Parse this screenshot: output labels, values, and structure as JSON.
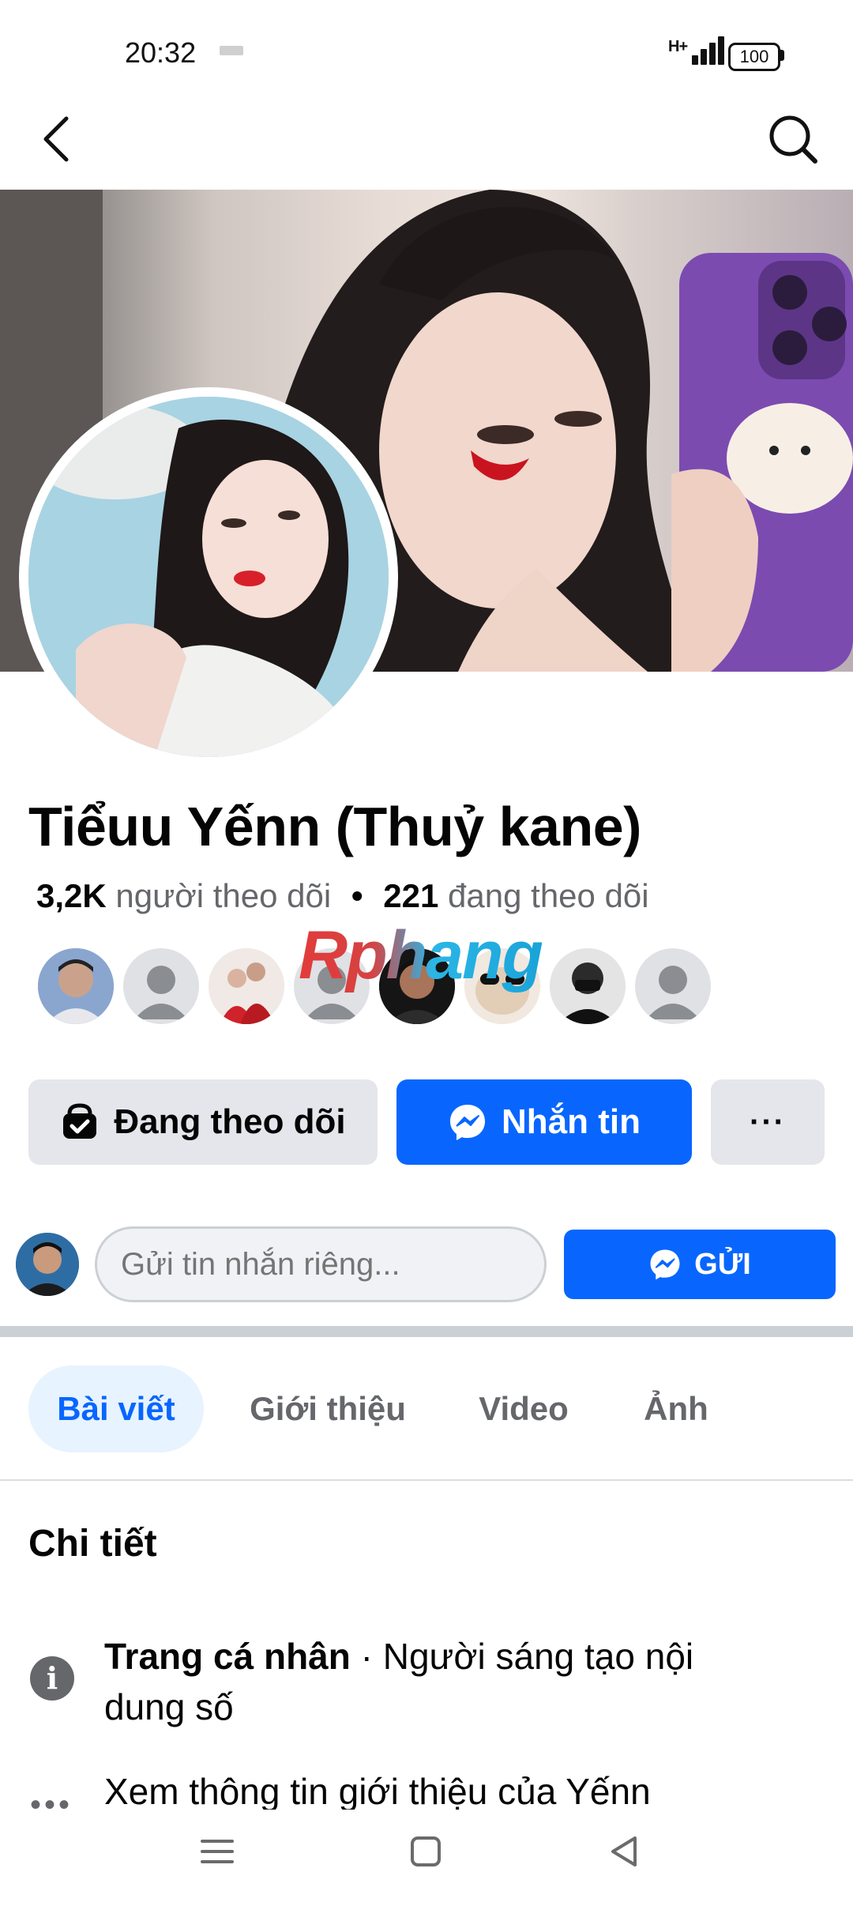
{
  "status_bar": {
    "time": "20:32",
    "network": "H+",
    "battery": "100"
  },
  "top_bar": {
    "back_icon": "chevron-left-icon",
    "search_icon": "search-icon"
  },
  "profile": {
    "name": "Tiểuu Yếnn (Thuỷ kane)",
    "followers_count": "3,2K",
    "followers_label": "người theo dõi",
    "separator": "•",
    "following_count": "221",
    "following_label": "đang theo dõi",
    "watermark": "Rphang"
  },
  "actions": {
    "following_label": "Đang theo dõi",
    "message_label": "Nhắn tin",
    "more_label": "···"
  },
  "composer": {
    "placeholder": "Gửi tin nhắn riêng...",
    "send_label": "GỬI"
  },
  "tabs": [
    {
      "label": "Bài viết",
      "active": true
    },
    {
      "label": "Giới thiệu",
      "active": false
    },
    {
      "label": "Video",
      "active": false
    },
    {
      "label": "Ảnh",
      "active": false
    }
  ],
  "details": {
    "title": "Chi tiết",
    "page_type_bold": "Trang cá nhân",
    "page_type_rest": " · Người sáng tạo nội dung số",
    "see_about": "Xem thông tin giới thiệu của Yếnn"
  },
  "colors": {
    "accent": "#0866ff",
    "button_gray": "#e4e6eb",
    "secondary_text": "#65676b"
  }
}
